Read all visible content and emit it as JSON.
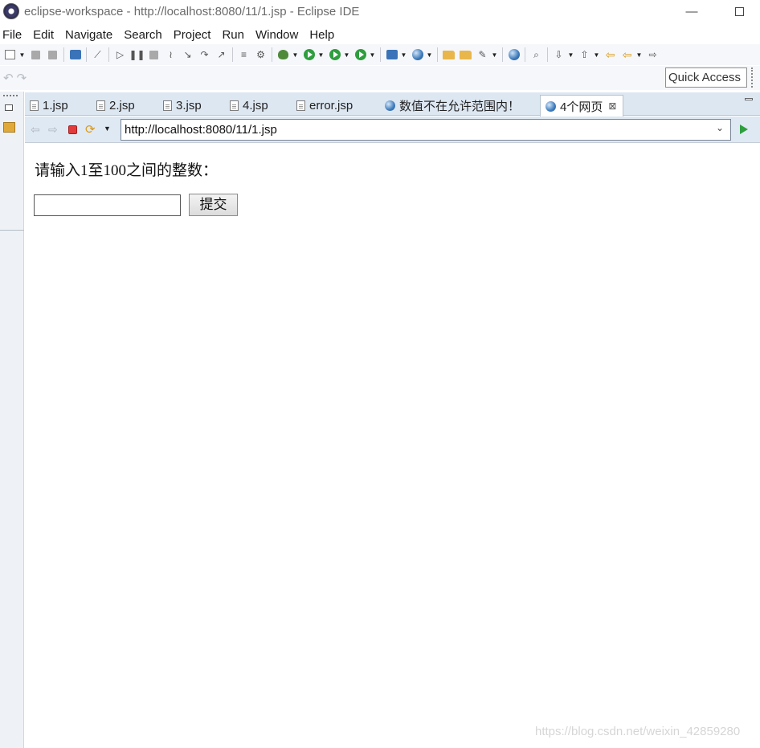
{
  "window": {
    "title": "eclipse-workspace - http://localhost:8080/11/1.jsp - Eclipse IDE",
    "minimize_glyph": "—"
  },
  "menu": [
    "File",
    "Edit",
    "Navigate",
    "Search",
    "Project",
    "Run",
    "Window",
    "Help"
  ],
  "toolbar": {
    "quick_access": "Quick Access"
  },
  "tabs": [
    {
      "label": "1.jsp",
      "icon": "jsp-file-icon"
    },
    {
      "label": "2.jsp",
      "icon": "jsp-file-icon"
    },
    {
      "label": "3.jsp",
      "icon": "jsp-file-icon"
    },
    {
      "label": "4.jsp",
      "icon": "jsp-file-icon"
    },
    {
      "label": "error.jsp",
      "icon": "jsp-file-icon"
    },
    {
      "label": "数值不在允许范围内！",
      "icon": "globe-icon"
    },
    {
      "label": "4个网页",
      "icon": "globe-icon",
      "active": true
    }
  ],
  "browser": {
    "url": "http://localhost:8080/11/1.jsp"
  },
  "page": {
    "prompt": "请输入1至100之间的整数：",
    "input_value": "",
    "submit_label": "提交"
  },
  "watermark": "https://blog.csdn.net/weixin_42859280",
  "colors": {
    "tab_bar": "#dde7f2",
    "nav_bar": "#dfe9f4",
    "stop_red": "#e23b3b",
    "go_green": "#2e9e3e"
  }
}
